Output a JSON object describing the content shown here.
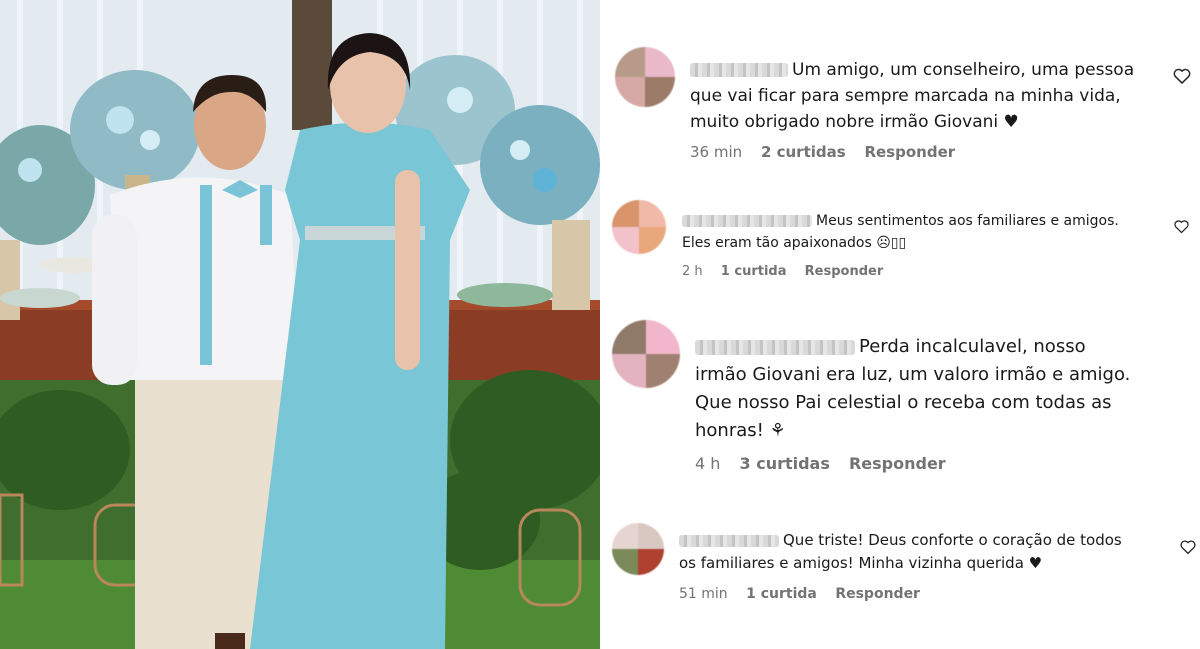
{
  "photo": {
    "description_icon": "wedding-couple-photo"
  },
  "comments": [
    {
      "text_lines": [
        "Um amigo, um conselheiro, uma pessoa",
        "que vai ficar para sempre marcada na minha vida,",
        "muito obrigado nobre irmão Giovani ♥"
      ],
      "time": "36 min",
      "likes": "2 curtidas",
      "reply": "Responder"
    },
    {
      "text_lines": [
        "Meus sentimentos aos familiares e amigos.",
        "Eles eram tão apaixonados ☹︎▯▯"
      ],
      "time": "2 h",
      "likes": "1 curtida",
      "reply": "Responder"
    },
    {
      "text_lines": [
        "Perda incalculavel, nosso",
        "irmão Giovani era luz, um valoro irmão e amigo.",
        "Que nosso Pai celestial o receba com todas as",
        "honras! ⚘"
      ],
      "time": "4 h",
      "likes": "3 curtidas",
      "reply": "Responder"
    },
    {
      "text_lines": [
        "Que triste! Deus conforte o coração de todos",
        "os familiares e amigos! Minha vizinha querida ♥"
      ],
      "time": "51 min",
      "likes": "1 curtida",
      "reply": "Responder"
    }
  ],
  "icons": {
    "like": "heart-outline-icon"
  }
}
